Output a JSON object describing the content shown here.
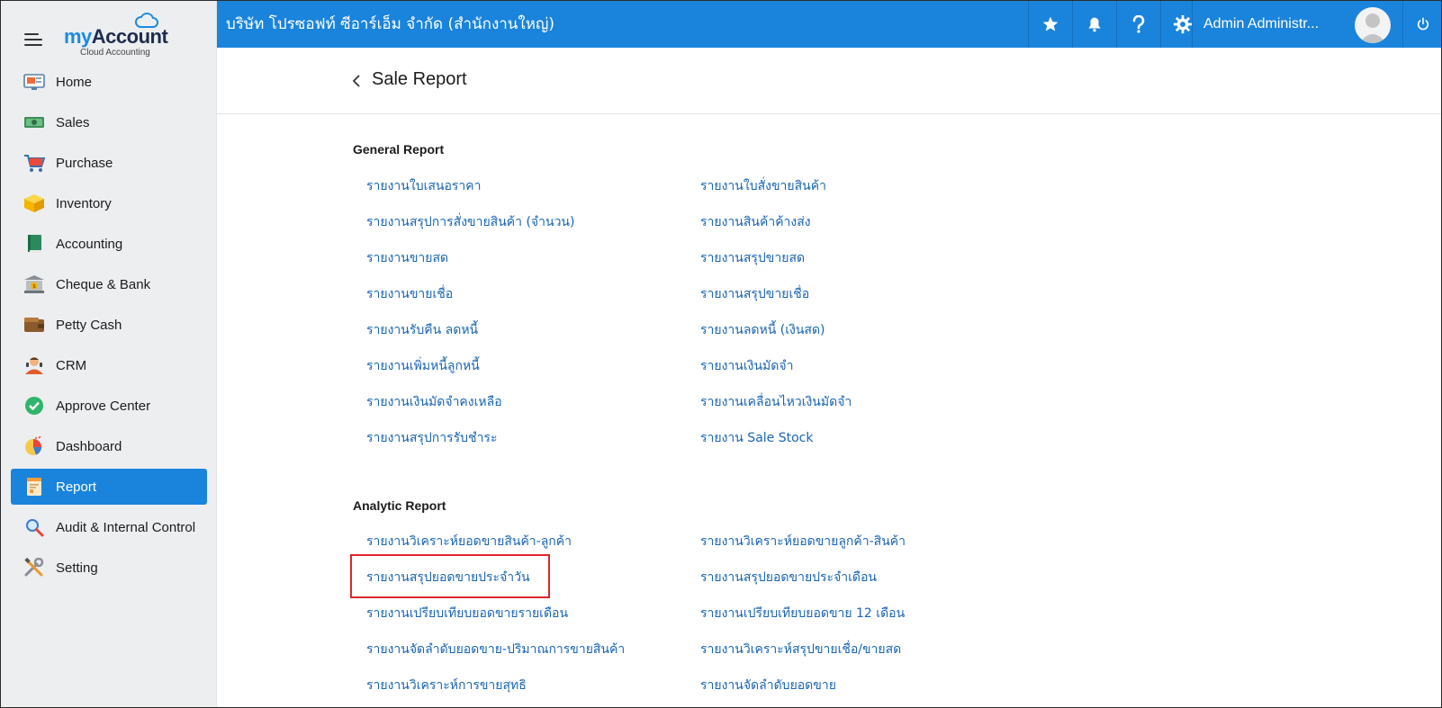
{
  "app": {
    "logo_my": "my",
    "logo_account": "Account",
    "logo_subtitle": "Cloud Accounting"
  },
  "sidebar": {
    "items": [
      {
        "label": "Home",
        "icon": "home-monitor-icon"
      },
      {
        "label": "Sales",
        "icon": "cash-icon"
      },
      {
        "label": "Purchase",
        "icon": "shopping-cart-icon"
      },
      {
        "label": "Inventory",
        "icon": "box-icon"
      },
      {
        "label": "Accounting",
        "icon": "book-icon"
      },
      {
        "label": "Cheque & Bank",
        "icon": "bank-icon"
      },
      {
        "label": "Petty Cash",
        "icon": "wallet-icon"
      },
      {
        "label": "CRM",
        "icon": "person-icon"
      },
      {
        "label": "Approve Center",
        "icon": "check-circle-icon"
      },
      {
        "label": "Dashboard",
        "icon": "pie-chart-icon"
      },
      {
        "label": "Report",
        "icon": "report-icon"
      },
      {
        "label": "Audit & Internal Control",
        "icon": "magnifier-icon"
      },
      {
        "label": "Setting",
        "icon": "tools-icon"
      }
    ],
    "active_index": 10
  },
  "topbar": {
    "company": "บริษัท โปรซอฟท์ ซีอาร์เอ็ม จำกัด (สำนักงานใหญ่)",
    "user_name": "Admin Administr...",
    "icons": [
      "star-icon",
      "bell-icon",
      "help-icon",
      "gear-icon",
      "power-icon"
    ]
  },
  "page": {
    "title": "Sale Report"
  },
  "general": {
    "title": "General Report",
    "left": [
      "รายงานใบเสนอราคา",
      "รายงานสรุปการสั่งขายสินค้า (จำนวน)",
      "รายงานขายสด",
      "รายงานขายเชื่อ",
      "รายงานรับคืน ลดหนี้",
      "รายงานเพิ่มหนี้ลูกหนี้",
      "รายงานเงินมัดจำคงเหลือ",
      "รายงานสรุปการรับชำระ"
    ],
    "right": [
      "รายงานใบสั่งขายสินค้า",
      "รายงานสินค้าค้างส่ง",
      "รายงานสรุปขายสด",
      "รายงานสรุปขายเชื่อ",
      "รายงานลดหนี้ (เงินสด)",
      "รายงานเงินมัดจำ",
      "รายงานเคลื่อนไหวเงินมัดจำ",
      "รายงาน Sale Stock"
    ]
  },
  "analytic": {
    "title": "Analytic Report",
    "left": [
      "รายงานวิเคราะห์ยอดขายสินค้า-ลูกค้า",
      "รายงานสรุปยอดขายประจำวัน",
      "รายงานเปรียบเทียบยอดขายรายเดือน",
      "รายงานจัดลำดับยอดขาย-ปริมาณการขายสินค้า",
      "รายงานวิเคราะห์การขายสุทธิ"
    ],
    "right": [
      "รายงานวิเคราะห์ยอดขายลูกค้า-สินค้า",
      "รายงานสรุปยอดขายประจำเดือน",
      "รายงานเปรียบเทียบยอดขาย 12 เดือน",
      "รายงานวิเคราะห์สรุปขายเชื่อ/ขายสด",
      "รายงานจัดลำดับยอดขาย"
    ]
  },
  "colors": {
    "primary": "#1a84dc",
    "link": "#1a65b5",
    "highlight": "#e0262b",
    "sidebar_bg": "#eceef0"
  }
}
